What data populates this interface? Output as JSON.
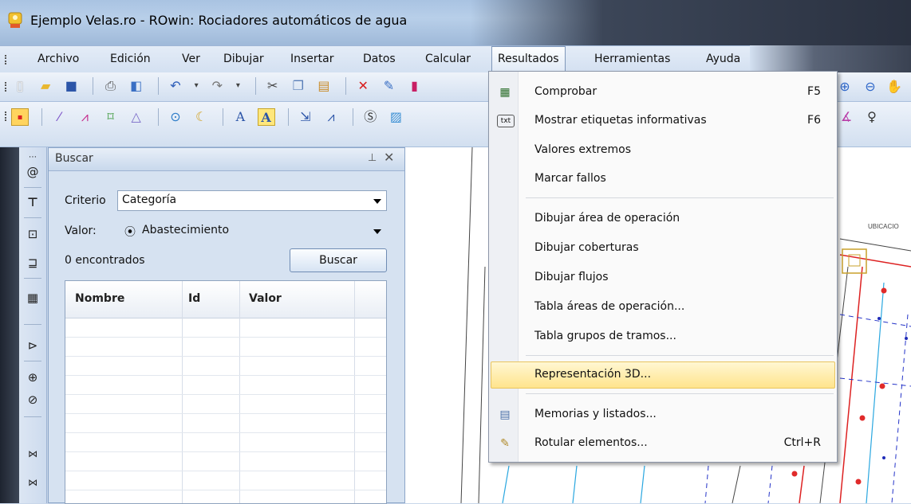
{
  "window": {
    "title": "Ejemplo Velas.ro - ROwin: Rociadores automáticos de agua"
  },
  "menubar": {
    "items": [
      "Archivo",
      "Edición",
      "Ver",
      "Dibujar",
      "Insertar",
      "Datos",
      "Calcular",
      "Resultados",
      "Herramientas",
      "Ayuda"
    ],
    "active": "Resultados"
  },
  "search_panel": {
    "title": "Buscar",
    "criterio_label": "Criterio",
    "criterio_value": "Categoría",
    "valor_label": "Valor:",
    "valor_value": "Abastecimiento",
    "found_text": "0 encontrados",
    "buscar_button": "Buscar",
    "columns": [
      "Nombre",
      "Id",
      "Valor"
    ]
  },
  "dropdown": {
    "items": [
      {
        "label": "Comprobar",
        "shortcut": "F5",
        "icon": "check-table-icon"
      },
      {
        "label": "Mostrar etiquetas informativas",
        "shortcut": "F6",
        "icon": "txt-tooltip-icon"
      },
      {
        "label": "Valores extremos",
        "shortcut": "",
        "icon": ""
      },
      {
        "label": "Marcar fallos",
        "shortcut": "",
        "icon": ""
      },
      {
        "label": "Dibujar área de operación",
        "shortcut": "",
        "icon": ""
      },
      {
        "label": "Dibujar coberturas",
        "shortcut": "",
        "icon": ""
      },
      {
        "label": "Dibujar flujos",
        "shortcut": "",
        "icon": ""
      },
      {
        "label": "Tabla áreas de operación...",
        "shortcut": "",
        "icon": ""
      },
      {
        "label": "Tabla grupos de tramos...",
        "shortcut": "",
        "icon": ""
      },
      {
        "label": "Representación 3D...",
        "shortcut": "",
        "icon": ""
      },
      {
        "label": "Memorias y listados...",
        "shortcut": "",
        "icon": "report-icon"
      },
      {
        "label": "Rotular elementos...",
        "shortcut": "Ctrl+R",
        "icon": "label-elements-icon"
      }
    ],
    "highlighted": "Representación 3D..."
  },
  "drawing": {
    "label_text": "UBICACIO"
  },
  "colors": {
    "highlight": "#ffe48c",
    "menubar": "#d3e0f1",
    "panel": "#d6e2f1"
  }
}
